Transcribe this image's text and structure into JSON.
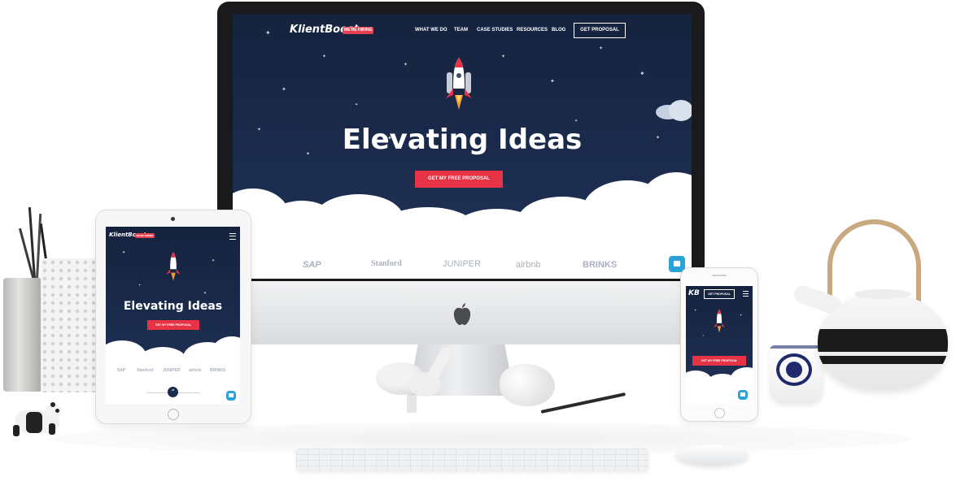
{
  "site": {
    "logo": "KlientBoost",
    "hiring_badge": "WE'RE HIRING",
    "nav": [
      "WHAT WE DO",
      "TEAM",
      "CASE STUDIES",
      "RESOURCES",
      "BLOG"
    ],
    "nav_button": "GET PROPOSAL",
    "headline": "Elevating Ideas",
    "cta": "GET MY FREE PROPOSAL",
    "partners": [
      "SAP",
      "Stanford",
      "JUNIPER",
      "airbnb",
      "BRINKS"
    ],
    "mobile_logo": "KB",
    "mobile_nav_button": "GET PROPOSAL"
  },
  "colors": {
    "night_sky": "#1b2b4c",
    "accent_red": "#e63346",
    "chat_blue": "#2aa3d8"
  },
  "icons": [
    "apple-logo-icon",
    "rocket-icon",
    "hamburger-menu-icon",
    "chat-icon",
    "quote-icon"
  ]
}
